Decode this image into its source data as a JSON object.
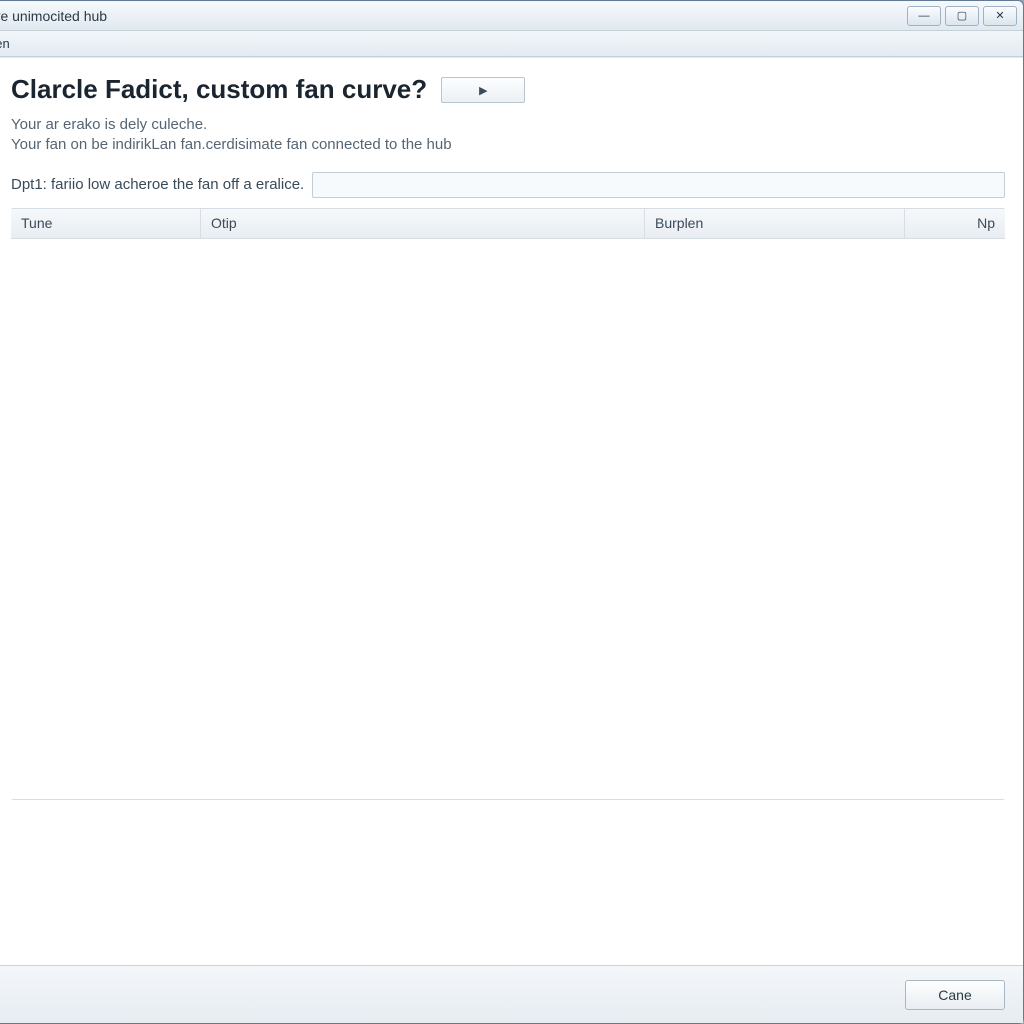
{
  "window": {
    "title": "urve unimocited hub"
  },
  "menubar": {
    "items": [
      "Hien"
    ]
  },
  "main": {
    "heading": "Clarcle Fadict, custom fan curve?",
    "heading_button_label": "▸",
    "description_line1": "Your ar erako is dely culeche.",
    "description_line2": "Your fan on be indirikLan fan.cerdisimate fan connected to the hub",
    "option_label": "Dpt1: fariio low acheroe the fan off a eralice.",
    "option_value": ""
  },
  "table": {
    "columns": [
      "Tune",
      "Otip",
      "Burplen",
      "Np"
    ]
  },
  "footer": {
    "close_label": "Cane"
  }
}
